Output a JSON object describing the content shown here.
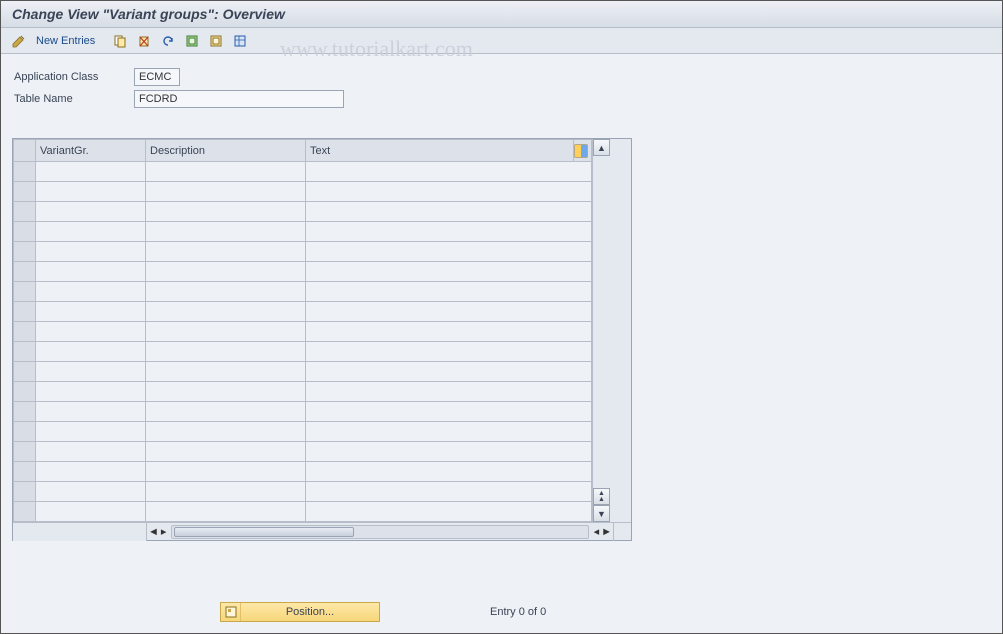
{
  "title": "Change View \"Variant groups\": Overview",
  "toolbar": {
    "new_entries_label": "New Entries"
  },
  "watermark": "www.tutorialkart.com",
  "form": {
    "application_class": {
      "label": "Application Class",
      "value": "ECMC"
    },
    "table_name": {
      "label": "Table Name",
      "value": "FCDRD"
    }
  },
  "table": {
    "columns": {
      "variant_group": "VariantGr.",
      "description": "Description",
      "text": "Text"
    },
    "rows": [
      {
        "variant": "",
        "description": "",
        "text": ""
      },
      {
        "variant": "",
        "description": "",
        "text": ""
      },
      {
        "variant": "",
        "description": "",
        "text": ""
      },
      {
        "variant": "",
        "description": "",
        "text": ""
      },
      {
        "variant": "",
        "description": "",
        "text": ""
      },
      {
        "variant": "",
        "description": "",
        "text": ""
      },
      {
        "variant": "",
        "description": "",
        "text": ""
      },
      {
        "variant": "",
        "description": "",
        "text": ""
      },
      {
        "variant": "",
        "description": "",
        "text": ""
      },
      {
        "variant": "",
        "description": "",
        "text": ""
      },
      {
        "variant": "",
        "description": "",
        "text": ""
      },
      {
        "variant": "",
        "description": "",
        "text": ""
      },
      {
        "variant": "",
        "description": "",
        "text": ""
      },
      {
        "variant": "",
        "description": "",
        "text": ""
      },
      {
        "variant": "",
        "description": "",
        "text": ""
      },
      {
        "variant": "",
        "description": "",
        "text": ""
      },
      {
        "variant": "",
        "description": "",
        "text": ""
      },
      {
        "variant": "",
        "description": "",
        "text": ""
      }
    ]
  },
  "footer": {
    "position_label": "Position...",
    "entry_text": "Entry 0 of 0"
  }
}
